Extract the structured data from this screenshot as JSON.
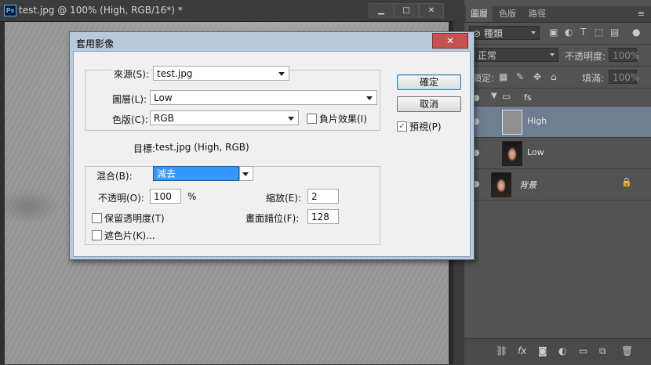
{
  "document": {
    "title": "test.jpg @ 100% (High, RGB/16*) *",
    "app_icon": "Ps",
    "min_icon": "▁",
    "max_icon": "□",
    "close_icon": "✕"
  },
  "dialog": {
    "title": "套用影像",
    "close_icon": "✕",
    "source": {
      "label": "來源(S):",
      "value": "test.jpg",
      "layer_label": "圖層(L):",
      "layer_value": "Low",
      "channel_label": "色版(C):",
      "channel_value": "RGB",
      "invert_label": "負片效果(I)",
      "invert_checked": false
    },
    "target": {
      "label": "目標:",
      "value": "test.jpg (High, RGB)"
    },
    "blending": {
      "label": "混合(B):",
      "value": "減去",
      "opacity_label": "不透明(O):",
      "opacity_value": "100",
      "opacity_unit": "%",
      "preserve_label": "保留透明度(T)",
      "preserve_checked": false,
      "mask_label": "遮色片(K)...",
      "mask_checked": false,
      "scale_label": "縮放(E):",
      "scale_value": "2",
      "offset_label": "畫面錯位(F):",
      "offset_value": "128"
    },
    "ok_label": "確定",
    "cancel_label": "取消",
    "preview_label": "預視(P)",
    "preview_checked": true
  },
  "panel": {
    "tabs": [
      "圖層",
      "色版",
      "路徑"
    ],
    "menu_icon": "≡",
    "filter": {
      "kind_label": "種類",
      "kind_icon": "⊘"
    },
    "blend_mode": "正常",
    "opacity_label": "不透明度:",
    "opacity_value": "100%",
    "lock_label": "鎖定:",
    "fill_label": "填滿:",
    "fill_value": "100%",
    "layers": [
      {
        "name": "fs",
        "type": "group"
      },
      {
        "name": "High",
        "type": "layer",
        "selected": true
      },
      {
        "name": "Low",
        "type": "layer"
      },
      {
        "name": "背景",
        "type": "background",
        "locked": true
      }
    ],
    "eye_icon": "●",
    "lock_icon": "🔒"
  }
}
